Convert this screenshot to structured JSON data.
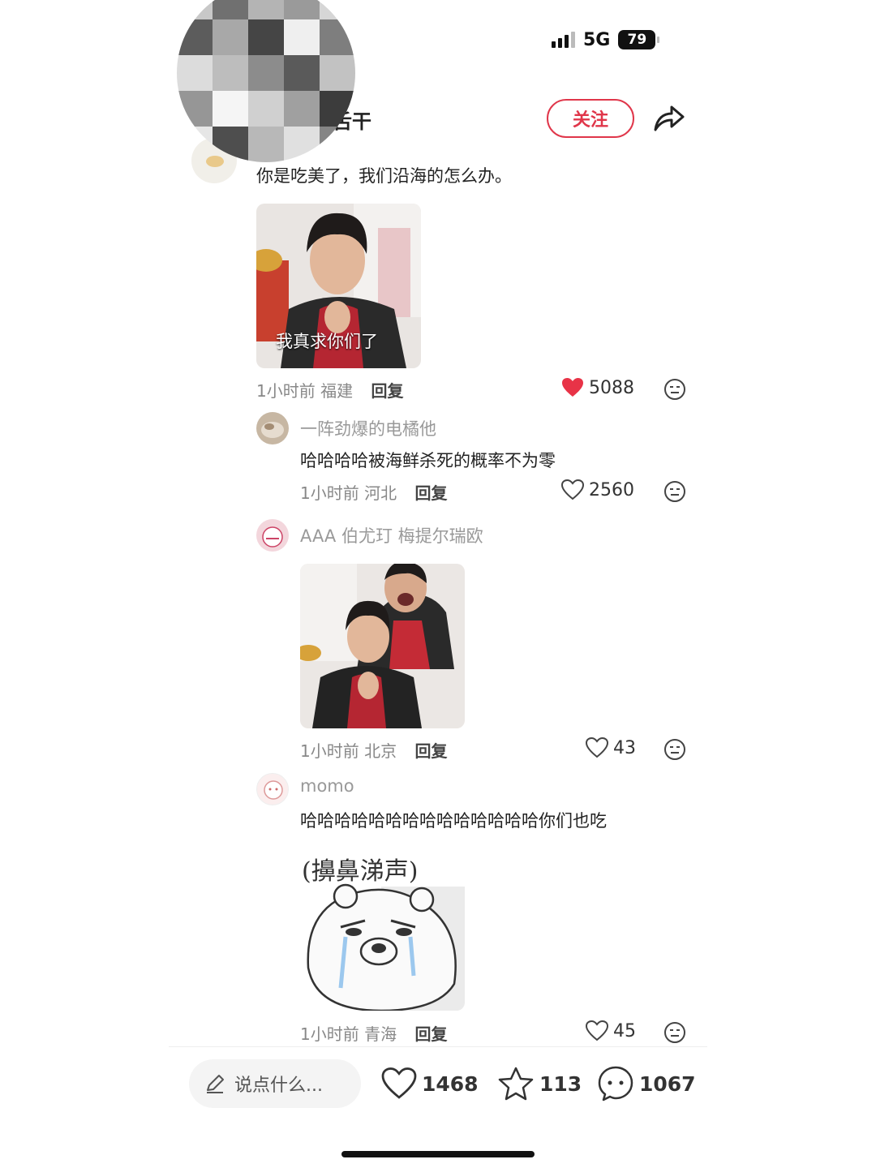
{
  "status_bar": {
    "network": "5G",
    "battery": "79"
  },
  "header": {
    "author_name_visible": "舌干",
    "follow_label": "关注"
  },
  "comments": [
    {
      "text": "你是吃美了，我们沿海的怎么办。",
      "image_caption": "我真求你们了",
      "time": "1小时前",
      "location": "福建",
      "reply_label": "回复",
      "likes": "5088"
    },
    {
      "name": "一阵劲爆的电橘他",
      "text": "哈哈哈哈被海鲜杀死的概率不为零",
      "time": "1小时前",
      "location": "河北",
      "reply_label": "回复",
      "likes": "2560"
    },
    {
      "name": "AAA 伯尤玎 梅提尔瑞欧",
      "time": "1小时前",
      "location": "北京",
      "reply_label": "回复",
      "likes": "43"
    },
    {
      "name": "momo",
      "text": "哈哈哈哈哈哈哈哈哈哈哈哈哈哈你们也吃",
      "sticker_text": "(擤鼻涕声)",
      "time": "1小时前",
      "location": "青海",
      "reply_label": "回复",
      "likes": "45"
    }
  ],
  "bottom_bar": {
    "input_placeholder": "说点什么...",
    "likes": "1468",
    "stars": "113",
    "comments": "1067"
  },
  "colors": {
    "accent": "#e0364a",
    "like_red": "#e83347",
    "text": "#222222",
    "muted": "#888888"
  }
}
